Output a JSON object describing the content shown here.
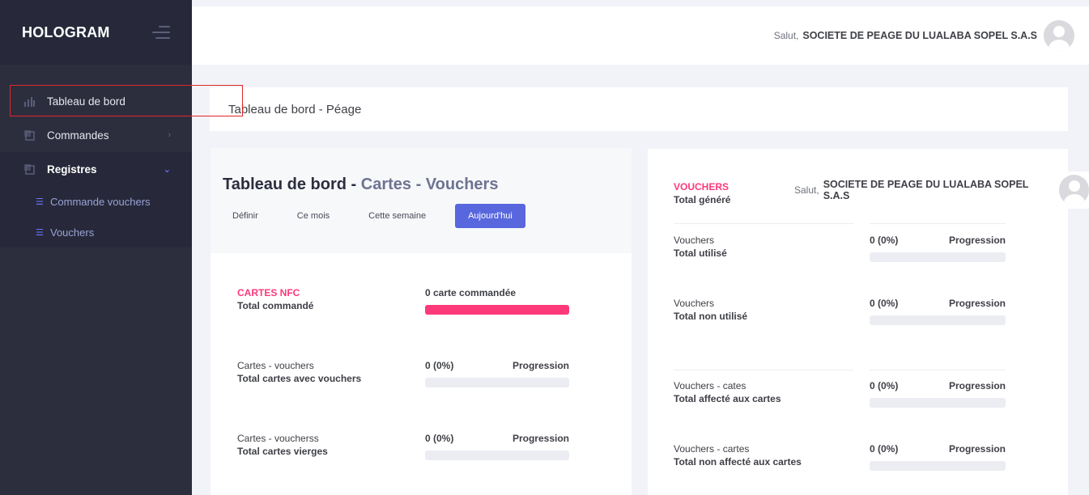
{
  "brand": "HOLOGRAM",
  "sidebar": {
    "items": [
      {
        "label": "Tableau de bord",
        "icon": "bar-chart-icon"
      },
      {
        "label": "Commandes",
        "icon": "copy-icon",
        "chevron": "›"
      },
      {
        "label": "Registres",
        "icon": "copy-icon",
        "chevron": "⌄"
      }
    ],
    "subitems": [
      {
        "label": "Commande vouchers",
        "icon": "list-icon"
      },
      {
        "label": "Vouchers",
        "icon": "list-icon"
      }
    ]
  },
  "header": {
    "greeting": "Salut,",
    "user": "SOCIETE DE PEAGE DU LUALABA SOPEL S.A.S"
  },
  "subheader": {
    "title": "Tableau de bord - Péage"
  },
  "left_card": {
    "title_main": "Tableau de bord - ",
    "title_accent": "Cartes - Vouchers",
    "filters": [
      "Définir",
      "Ce mois",
      "Cette semaine",
      "Aujourd'hui"
    ],
    "active_filter": "Aujourd'hui",
    "rows": [
      {
        "label1": "CARTES NFC",
        "label2": "Total commandé",
        "value": "0 carte commandée",
        "right": "",
        "progress": 1.0
      },
      {
        "label1": "Cartes - vouchers",
        "label2": "Total cartes avec vouchers",
        "value": "0 (0%)",
        "right": "Progression",
        "progress": 0
      },
      {
        "label1": "Cartes - voucherss",
        "label2": "Total cartes vierges",
        "value": "0 (0%)",
        "right": "Progression",
        "progress": 0
      }
    ]
  },
  "right_card": {
    "head_label1": "VOUCHERS",
    "head_label2": "Total généré",
    "rows": [
      {
        "label1": "Vouchers",
        "label2": "Total utilisé",
        "value": "0 (0%)",
        "right": "Progression",
        "progress": 0
      },
      {
        "label1": "Vouchers",
        "label2": "Total non utilisé",
        "value": "0 (0%)",
        "right": "Progression",
        "progress": 0
      },
      {
        "label1": "Vouchers - cates",
        "label2": "Total affecté aux cartes",
        "value": "0 (0%)",
        "right": "Progression",
        "progress": 0
      },
      {
        "label1": "Vouchers - cartes",
        "label2": "Total non affecté aux cartes",
        "value": "0 (0%)",
        "right": "Progression",
        "progress": 0
      }
    ]
  },
  "colors": {
    "accent": "#5867dd",
    "pink": "#fd397a",
    "sidebar": "#2c2e3e",
    "highlight": "#e0272b"
  }
}
